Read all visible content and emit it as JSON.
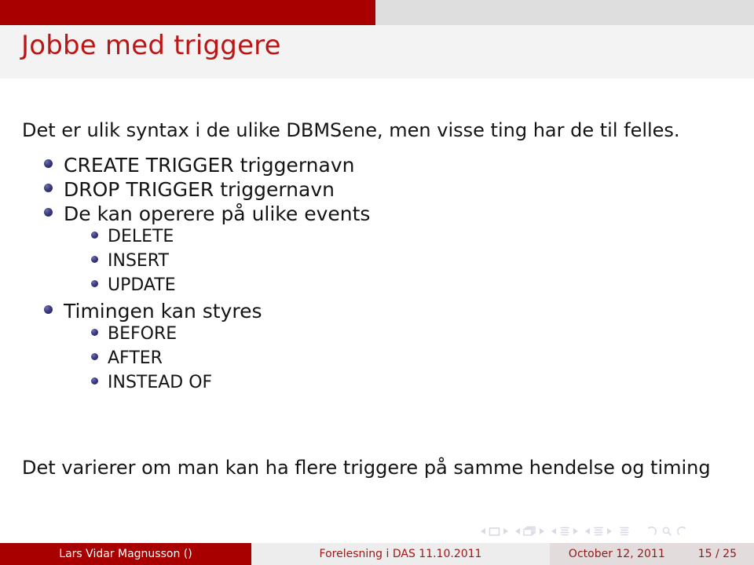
{
  "header": {
    "accent_color": "#a80000",
    "bar_right_color": "#dededf",
    "title": "Jobbe med triggere",
    "title_color": "#bb1616"
  },
  "body": {
    "intro": "Det er ulik syntax i de ulike DBMSene, men visse ting har de til felles.",
    "outro": "Det varierer om man kan ha flere triggere på samme hendelse og timing",
    "bullet_color": "#2d2d6e",
    "items": [
      {
        "level": 1,
        "label": "CREATE TRIGGER triggernavn"
      },
      {
        "level": 1,
        "label": "DROP TRIGGER triggernavn"
      },
      {
        "level": 1,
        "label": "De kan operere på ulike events"
      },
      {
        "level": 2,
        "label": "DELETE"
      },
      {
        "level": 2,
        "label": "INSERT"
      },
      {
        "level": 2,
        "label": "UPDATE"
      },
      {
        "level": 1,
        "label": "Timingen kan styres"
      },
      {
        "level": 2,
        "label": "BEFORE"
      },
      {
        "level": 2,
        "label": "AFTER"
      },
      {
        "level": 2,
        "label": "INSTEAD OF"
      }
    ]
  },
  "navigation": {
    "color": "#d9d9e6",
    "groups": [
      {
        "icon": "slide-icon",
        "prev": "prev-slide-icon",
        "next": "next-slide-icon"
      },
      {
        "icon": "frame-icon",
        "prev": "prev-frame-icon",
        "next": "next-frame-icon"
      },
      {
        "icon": "subsection-icon",
        "prev": "prev-subsection-icon",
        "next": "next-subsection-icon"
      },
      {
        "icon": "section-icon",
        "prev": "prev-section-icon",
        "next": "next-section-icon"
      }
    ],
    "presentation_icon": "presentation-icon",
    "back_icon": "back-icon",
    "search_icon": "search-icon",
    "forward_icon": "forward-icon"
  },
  "footer": {
    "author": "Lars Vidar Magnusson ()",
    "title": "Forelesning i DAS 11.10.2011",
    "date": "October 12, 2011",
    "page": "15 / 25"
  }
}
